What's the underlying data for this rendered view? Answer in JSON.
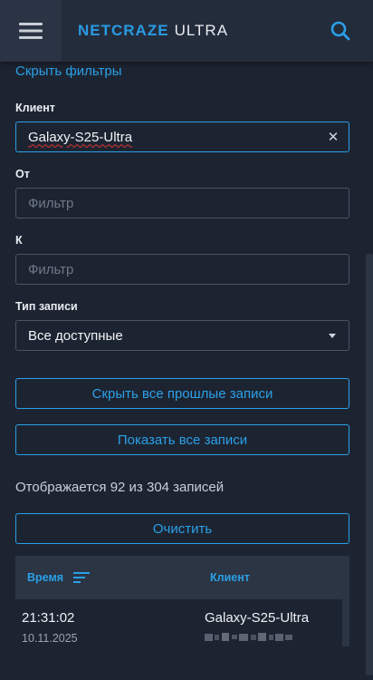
{
  "header": {
    "brand_primary": "NETCRAZE",
    "brand_secondary": "ULTRA",
    "menu_icon": "hamburger-menu-icon",
    "search_icon": "search-icon"
  },
  "filters": {
    "hide_filters_link": "Скрыть фильтры",
    "client_label": "Клиент",
    "client_value": "Galaxy-S25-Ultra",
    "from_label": "От",
    "from_placeholder": "Фильтр",
    "to_label": "К",
    "to_placeholder": "Фильтр",
    "type_label": "Тип записи",
    "type_value": "Все доступные"
  },
  "actions": {
    "hide_past_button": "Скрыть все прошлые записи",
    "show_all_button": "Показать все записи",
    "status_text": "Отображается 92 из 304 записей",
    "clear_button": "Очистить"
  },
  "table": {
    "columns": [
      "Время",
      "Клиент"
    ],
    "rows": [
      {
        "time": "21:31:02",
        "date": "10.11.2025",
        "client": "Galaxy-S25-Ultra"
      }
    ]
  },
  "colors": {
    "accent": "#2aa0e8",
    "background": "#1d2431",
    "header_bg": "#232c3b"
  }
}
